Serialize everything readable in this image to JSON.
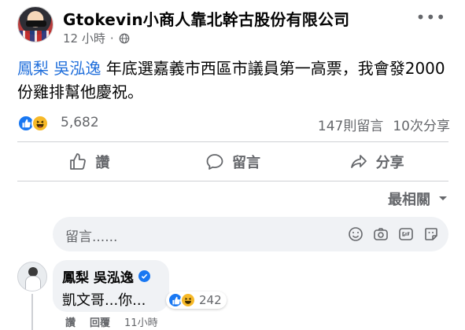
{
  "post": {
    "author": "Gtokevin小商人靠北幹古股份有限公司",
    "time": "12 小時",
    "separator": "·",
    "mention": "鳳梨 吳泓逸",
    "text": " 年底選嘉義市西區市議員第一高票，我會發2000份雞排幫他慶祝。"
  },
  "stats": {
    "reactions": "5,682",
    "comments": "147則留言",
    "shares": "10次分享"
  },
  "actions": {
    "like": "讚",
    "comment": "留言",
    "share": "分享"
  },
  "sort_label": "最相關",
  "comment_box": {
    "placeholder": "留言......"
  },
  "comment": {
    "author": "鳳梨 吳泓逸",
    "text": "凱文哥...你...",
    "reaction_count": "242",
    "like": "讚",
    "reply": "回覆",
    "time": "11小時"
  },
  "colors": {
    "like_blue": "#1877f2",
    "haha_yellow": "#f7b928",
    "mention": "#216fdb",
    "secondary_text": "#65676b"
  }
}
